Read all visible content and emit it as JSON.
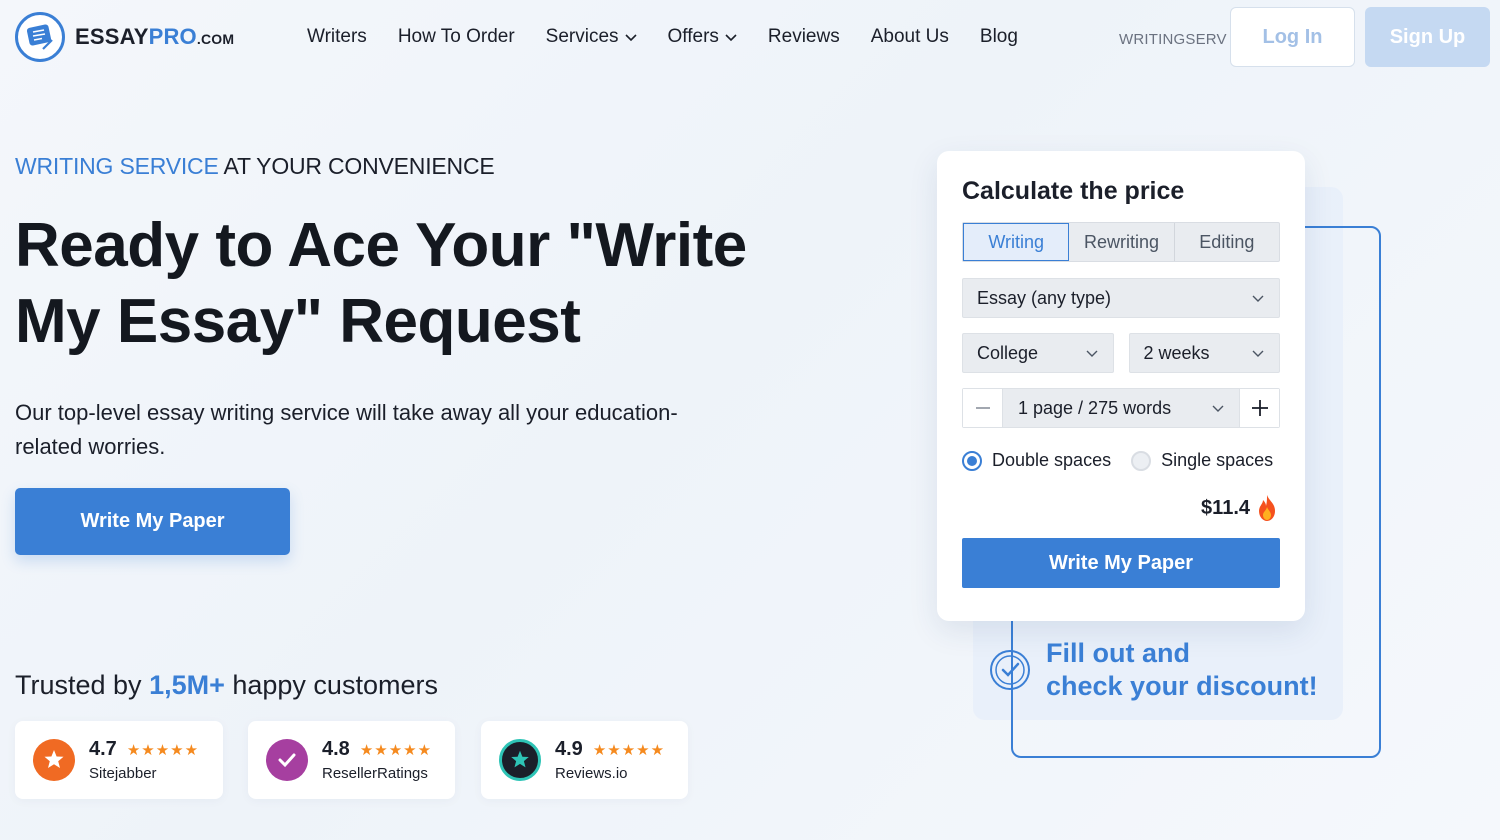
{
  "brand": {
    "name_main": "ESSAY",
    "name_accent": "PRO",
    "name_suffix": ".COM",
    "accent_color": "#3a7fd5"
  },
  "nav": {
    "items": [
      {
        "label": "Writers",
        "dropdown": false
      },
      {
        "label": "How To Order",
        "dropdown": false
      },
      {
        "label": "Services",
        "dropdown": true
      },
      {
        "label": "Offers",
        "dropdown": true
      },
      {
        "label": "Reviews",
        "dropdown": false
      },
      {
        "label": "About Us",
        "dropdown": false
      },
      {
        "label": "Blog",
        "dropdown": false
      }
    ],
    "promo_code": "WRITINGSERV",
    "login_label": "Log In",
    "signup_label": "Sign Up"
  },
  "hero": {
    "eyebrow_accent": "WRITING SERVICE",
    "eyebrow_rest": " AT YOUR CONVENIENCE",
    "title_line1": "Ready to Ace Your \"Write",
    "title_line2": "My Essay\" Request",
    "subtitle": "Our top-level essay writing service will take away all your education-related worries.",
    "cta_label": "Write My Paper"
  },
  "trust": {
    "prefix": "Trusted by ",
    "count": "1,5M+",
    "suffix": " happy customers",
    "ratings": [
      {
        "score": "4.7",
        "stars": "★★★★★",
        "source": "Sitejabber",
        "logo_color": "#f06a23"
      },
      {
        "score": "4.8",
        "stars": "★★★★★",
        "source": "ResellerRatings",
        "logo_color": "#a63fa0"
      },
      {
        "score": "4.9",
        "stars": "★★★★★",
        "source": "Reviews.io",
        "logo_color": "#1b1f2a"
      }
    ]
  },
  "calculator": {
    "title": "Calculate the price",
    "tabs": [
      "Writing",
      "Rewriting",
      "Editing"
    ],
    "active_tab": "Writing",
    "paper_type": "Essay (any type)",
    "level": "College",
    "deadline": "2 weeks",
    "pages": "1 page / 275 words",
    "spacing_options": [
      "Double spaces",
      "Single spaces"
    ],
    "spacing_selected": "Double spaces",
    "price": "$11.4",
    "cta_label": "Write My Paper"
  },
  "discount": {
    "line1": "Fill out and",
    "line2": "check your discount!"
  }
}
